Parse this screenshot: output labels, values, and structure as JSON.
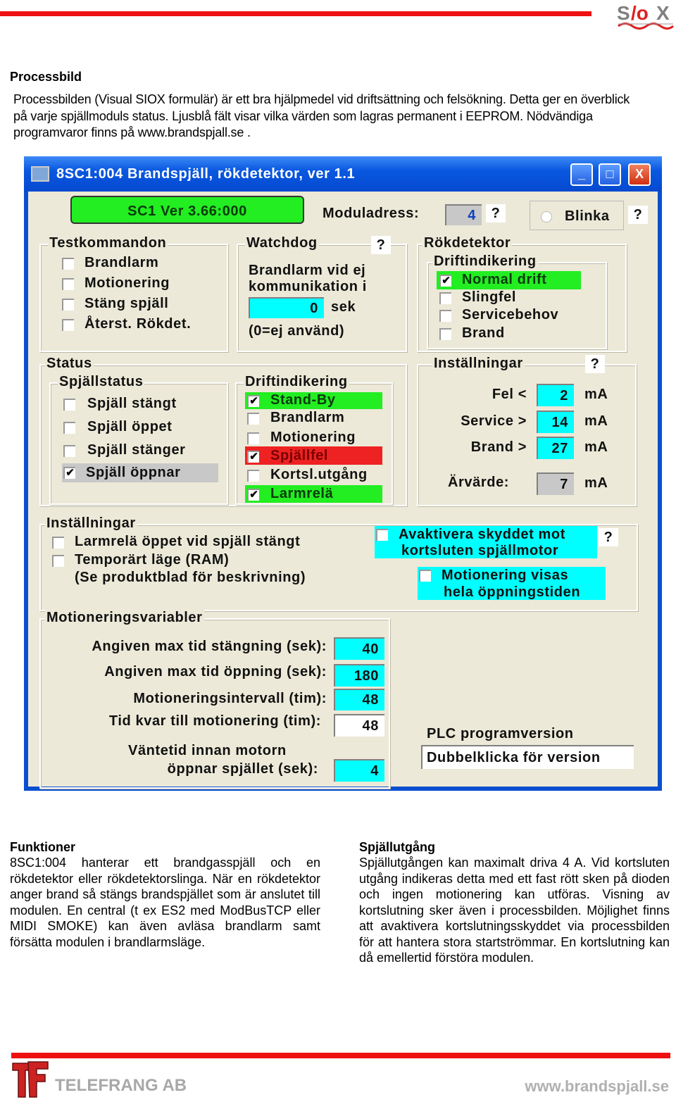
{
  "header": {
    "logo_text": "SI/OX",
    "colors": {
      "rule": "#ee1111",
      "logo_gray": "#808080",
      "logo_red": "#dd2222"
    }
  },
  "intro": {
    "heading": "Processbild",
    "paragraph": "Processbilden (Visual SIOX formulär) är ett bra hjälpmedel vid driftsättning och felsökning. Detta ger en överblick på varje spjällmoduls status. Ljusblå fält visar vilka värden som lagras permanent i EEPROM. Nödvändiga programvaror finns på www.brandspjall.se ."
  },
  "window": {
    "title": "8SC1:004 Brandspjäll, rökdetektor, ver 1.1",
    "buttons": {
      "minimize": "_",
      "maximize": "□",
      "close": "X"
    },
    "version_badge": "SC1 Ver 3.66:000",
    "moduladress_label": "Moduladress:",
    "moduladress_value": "4",
    "help": "?",
    "blinka_label": "Blinka",
    "testkommandon": {
      "title": "Testkommandon",
      "items": [
        "Brandlarm",
        "Motionering",
        "Stäng spjäll",
        "Återst. Rökdet."
      ]
    },
    "watchdog": {
      "title": "Watchdog",
      "line1": "Brandlarm vid ej",
      "line2": "kommunikation i",
      "value": "0",
      "unit": "sek",
      "note": "(0=ej använd)"
    },
    "rokdetektor": {
      "title": "Rökdetektor",
      "sub_title": "Driftindikering",
      "items": [
        {
          "label": "Normal drift",
          "checked": true,
          "color": "#22ee22"
        },
        {
          "label": "Slingfel",
          "checked": false
        },
        {
          "label": "Servicebehov",
          "checked": false
        },
        {
          "label": "Brand",
          "checked": false
        }
      ]
    },
    "status": {
      "title": "Status",
      "spjallstatus": {
        "title": "Spjällstatus",
        "items": [
          {
            "label": "Spjäll stängt",
            "checked": false
          },
          {
            "label": "Spjäll öppet",
            "checked": false
          },
          {
            "label": "Spjäll stänger",
            "checked": false
          },
          {
            "label": "Spjäll öppnar",
            "checked": true,
            "color": "#c8c8c8"
          }
        ]
      },
      "driftindikering": {
        "title": "Driftindikering",
        "items": [
          {
            "label": "Stand-By",
            "checked": true,
            "color": "#22ee22"
          },
          {
            "label": "Brandlarm",
            "checked": false
          },
          {
            "label": "Motionering",
            "checked": false
          },
          {
            "label": "Spjällfel",
            "checked": true,
            "color": "#ee2222"
          },
          {
            "label": "Kortsl.utgång",
            "checked": false
          },
          {
            "label": "Larmrelä",
            "checked": true,
            "color": "#22ee22"
          }
        ]
      }
    },
    "installningar_ma": {
      "title": "Inställningar",
      "rows": [
        {
          "label": "Fel <",
          "value": "2",
          "unit": "mA"
        },
        {
          "label": "Service >",
          "value": "14",
          "unit": "mA"
        },
        {
          "label": "Brand >",
          "value": "27",
          "unit": "mA"
        },
        {
          "label": "Ärvärde:",
          "value": "7",
          "unit": "mA"
        }
      ]
    },
    "installningar": {
      "title": "Inställningar",
      "opt1": "Larmrelä öppet vid spjäll stängt",
      "opt2": "Temporärt läge (RAM)",
      "note": "(Se produktblad för beskrivning)",
      "avaktivera_l1": "Avaktivera skyddet mot",
      "avaktivera_l2": "kortsluten spjällmotor",
      "motion_l1": "Motionering visas",
      "motion_l2": "hela öppningstiden"
    },
    "motionering": {
      "title": "Motioneringsvariabler",
      "rows": [
        {
          "label": "Angiven max tid stängning (sek):",
          "value": "40"
        },
        {
          "label": "Angiven max tid öppning (sek):",
          "value": "180"
        },
        {
          "label": "Motioneringsintervall (tim):",
          "value": "48"
        },
        {
          "label": "Tid kvar till motionering (tim):",
          "value": "48"
        }
      ],
      "wait_l1": "Väntetid innan motorn",
      "wait_l2": "öppnar spjället (sek):",
      "wait_value": "4"
    },
    "plc": {
      "label": "PLC programversion",
      "value": "Dubbelklicka för version"
    }
  },
  "funktioner": {
    "heading": "Funktioner",
    "text": "8SC1:004 hanterar ett brandgasspjäll och en rökdetektor eller rökdetektorslinga. När en rökdetektor anger brand så stängs brandspjället som är anslutet till modulen. En central (t ex ES2 med ModBusTCP eller MIDI SMOKE) kan även avläsa brandlarm samt försätta modulen i brandlarmsläge."
  },
  "spjallutgang": {
    "heading": "Spjällutgång",
    "text": "Spjällutgången kan maximalt driva 4 A. Vid kortsluten utgång indikeras detta med ett fast rött sken på dioden och ingen motionering kan utföras. Visning av kortslutning sker även i processbilden. Möjlighet finns att avaktivera kortslutningsskyddet via processbilden för att hantera stora startströmmar. En kortslutning kan då emellertid förstöra modulen."
  },
  "footer": {
    "company": "TELEFRANG AB",
    "website": "www.brandspjall.se",
    "logo_text": "TF"
  }
}
